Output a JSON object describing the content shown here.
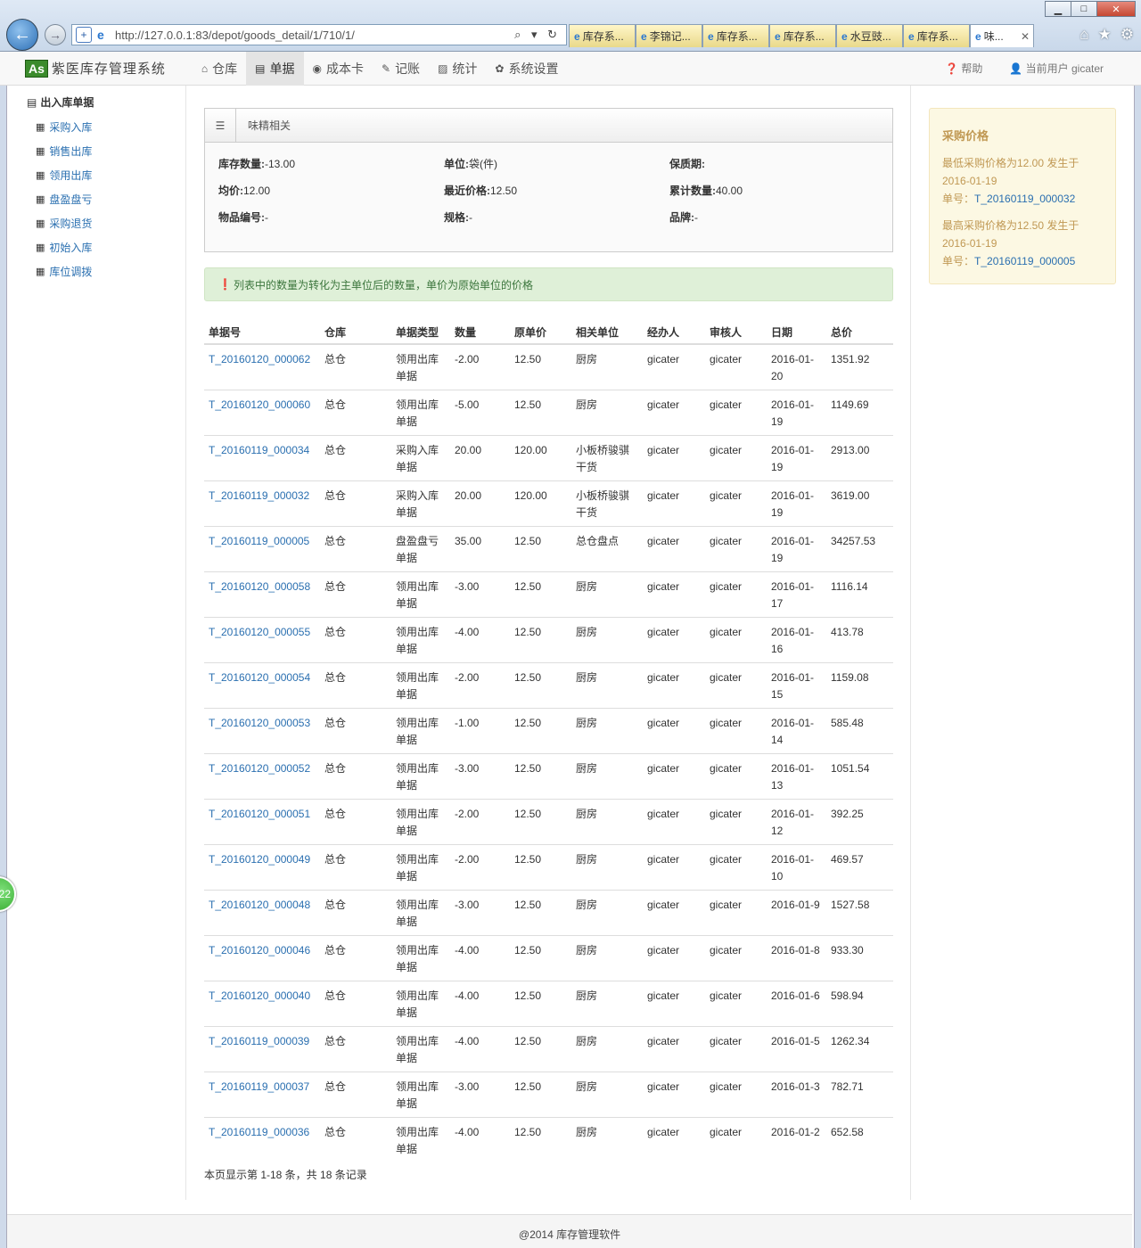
{
  "browser": {
    "url": "http://127.0.0.1:83/depot/goods_detail/1/710/1/",
    "tabs": [
      "库存系...",
      "李锦记...",
      "库存系...",
      "库存系...",
      "水豆豉...",
      "库存系...",
      "味..."
    ],
    "address_tools": "⌕ ▾ ↻"
  },
  "app": {
    "logo_badge": "As",
    "logo_name": "紫医库存管理系统",
    "nav": [
      {
        "icon": "home-icon",
        "glyph": "⌂",
        "label": "仓库"
      },
      {
        "icon": "list-icon",
        "glyph": "▤",
        "label": "单据"
      },
      {
        "icon": "eye-icon",
        "glyph": "◉",
        "label": "成本卡"
      },
      {
        "icon": "pencil-icon",
        "glyph": "✎",
        "label": "记账"
      },
      {
        "icon": "picture-icon",
        "glyph": "▨",
        "label": "统计"
      },
      {
        "icon": "gear-icon",
        "glyph": "✿",
        "label": "系统设置"
      }
    ],
    "help": "帮助",
    "current_user": "当前用户 gicater"
  },
  "sidebar": {
    "title": "出入库单据",
    "items": [
      "采购入库",
      "销售出库",
      "领用出库",
      "盘盈盘亏",
      "采购退货",
      "初始入库",
      "库位调拨"
    ]
  },
  "panel": {
    "title": "味精相关",
    "fields": [
      {
        "label": "库存数量:",
        "value": "-13.00"
      },
      {
        "label": "单位:",
        "value": "袋(件)"
      },
      {
        "label": "保质期:",
        "value": ""
      },
      {
        "label": "均价:",
        "value": "12.00"
      },
      {
        "label": "最近价格:",
        "value": "12.50"
      },
      {
        "label": "累计数量:",
        "value": "40.00"
      },
      {
        "label": "物品编号:",
        "value": "-"
      },
      {
        "label": "规格:",
        "value": "-"
      },
      {
        "label": "品牌:",
        "value": "-"
      }
    ]
  },
  "alert": "列表中的数量为转化为主单位后的数量，单价为原始单位的价格",
  "table": {
    "headers": [
      "单据号",
      "仓库",
      "单据类型",
      "数量",
      "原单价",
      "相关单位",
      "经办人",
      "审核人",
      "日期",
      "总价"
    ],
    "rows": [
      [
        "T_20160120_000062",
        "总仓",
        "领用出库单据",
        "-2.00",
        "12.50",
        "厨房",
        "gicater",
        "gicater",
        "2016-01-20",
        "1351.92"
      ],
      [
        "T_20160120_000060",
        "总仓",
        "领用出库单据",
        "-5.00",
        "12.50",
        "厨房",
        "gicater",
        "gicater",
        "2016-01-19",
        "1149.69"
      ],
      [
        "T_20160119_000034",
        "总仓",
        "采购入库单据",
        "20.00",
        "120.00",
        "小板桥骏骐干货",
        "gicater",
        "gicater",
        "2016-01-19",
        "2913.00"
      ],
      [
        "T_20160119_000032",
        "总仓",
        "采购入库单据",
        "20.00",
        "120.00",
        "小板桥骏骐干货",
        "gicater",
        "gicater",
        "2016-01-19",
        "3619.00"
      ],
      [
        "T_20160119_000005",
        "总仓",
        "盘盈盘亏单据",
        "35.00",
        "12.50",
        "总仓盘点",
        "gicater",
        "gicater",
        "2016-01-19",
        "34257.53"
      ],
      [
        "T_20160120_000058",
        "总仓",
        "领用出库单据",
        "-3.00",
        "12.50",
        "厨房",
        "gicater",
        "gicater",
        "2016-01-17",
        "1116.14"
      ],
      [
        "T_20160120_000055",
        "总仓",
        "领用出库单据",
        "-4.00",
        "12.50",
        "厨房",
        "gicater",
        "gicater",
        "2016-01-16",
        "413.78"
      ],
      [
        "T_20160120_000054",
        "总仓",
        "领用出库单据",
        "-2.00",
        "12.50",
        "厨房",
        "gicater",
        "gicater",
        "2016-01-15",
        "1159.08"
      ],
      [
        "T_20160120_000053",
        "总仓",
        "领用出库单据",
        "-1.00",
        "12.50",
        "厨房",
        "gicater",
        "gicater",
        "2016-01-14",
        "585.48"
      ],
      [
        "T_20160120_000052",
        "总仓",
        "领用出库单据",
        "-3.00",
        "12.50",
        "厨房",
        "gicater",
        "gicater",
        "2016-01-13",
        "1051.54"
      ],
      [
        "T_20160120_000051",
        "总仓",
        "领用出库单据",
        "-2.00",
        "12.50",
        "厨房",
        "gicater",
        "gicater",
        "2016-01-12",
        "392.25"
      ],
      [
        "T_20160120_000049",
        "总仓",
        "领用出库单据",
        "-2.00",
        "12.50",
        "厨房",
        "gicater",
        "gicater",
        "2016-01-10",
        "469.57"
      ],
      [
        "T_20160120_000048",
        "总仓",
        "领用出库单据",
        "-3.00",
        "12.50",
        "厨房",
        "gicater",
        "gicater",
        "2016-01-9",
        "1527.58"
      ],
      [
        "T_20160120_000046",
        "总仓",
        "领用出库单据",
        "-4.00",
        "12.50",
        "厨房",
        "gicater",
        "gicater",
        "2016-01-8",
        "933.30"
      ],
      [
        "T_20160120_000040",
        "总仓",
        "领用出库单据",
        "-4.00",
        "12.50",
        "厨房",
        "gicater",
        "gicater",
        "2016-01-6",
        "598.94"
      ],
      [
        "T_20160119_000039",
        "总仓",
        "领用出库单据",
        "-4.00",
        "12.50",
        "厨房",
        "gicater",
        "gicater",
        "2016-01-5",
        "1262.34"
      ],
      [
        "T_20160119_000037",
        "总仓",
        "领用出库单据",
        "-3.00",
        "12.50",
        "厨房",
        "gicater",
        "gicater",
        "2016-01-3",
        "782.71"
      ],
      [
        "T_20160119_000036",
        "总仓",
        "领用出库单据",
        "-4.00",
        "12.50",
        "厨房",
        "gicater",
        "gicater",
        "2016-01-2",
        "652.58"
      ]
    ]
  },
  "pagination": "本页显示第 1-18 条，共 18 条记录",
  "purchase_price": {
    "title": "采购价格",
    "min_text": "最低采购价格为12.00 发生于2016-01-19",
    "min_doc_label": "单号：",
    "min_doc": "T_20160119_000032",
    "max_text": "最高采购价格为12.50 发生于2016-01-19",
    "max_doc_label": "单号：",
    "max_doc": "T_20160119_000005"
  },
  "footer": "@2014 库存管理软件",
  "bubble": "22"
}
